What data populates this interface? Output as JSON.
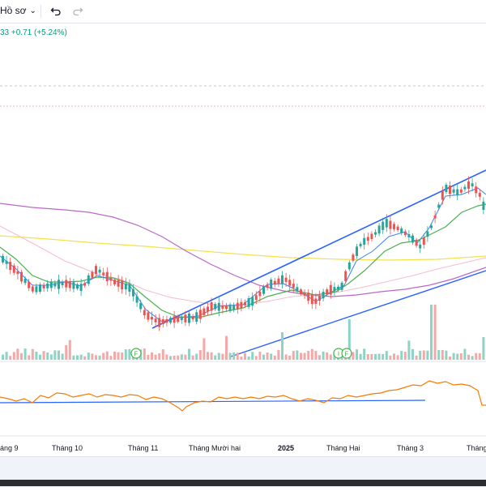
{
  "toolbar": {
    "profile_label": "Hồ sơ",
    "undo_icon": "undo-icon",
    "redo_icon": "redo-icon",
    "chevron_icon": "chevron-down-icon"
  },
  "legend": {
    "text": "33 +0.71 (+5.24%)",
    "color": "#089981"
  },
  "markers": {
    "earnings_1": "F",
    "earnings_2": "F",
    "earnings_3": "F",
    "earnings_3_prefix": "I"
  },
  "x_axis": {
    "labels": [
      "áng 9",
      "Tháng 10",
      "Tháng 11",
      "Tháng Mười hai",
      "2025",
      "Tháng Hai",
      "Tháng 3",
      "Tháng"
    ]
  },
  "colors": {
    "up": "#26a69a",
    "down": "#ef5350",
    "ma_fast": "#3b82f6",
    "ma_mid": "#4caf50",
    "ma_slow": "#ba68c8",
    "ma_long": "#f4e04d",
    "ma_pink": "#f8bbd0",
    "trendline": "#2962ff",
    "oscillator": "#f57c00"
  }
}
